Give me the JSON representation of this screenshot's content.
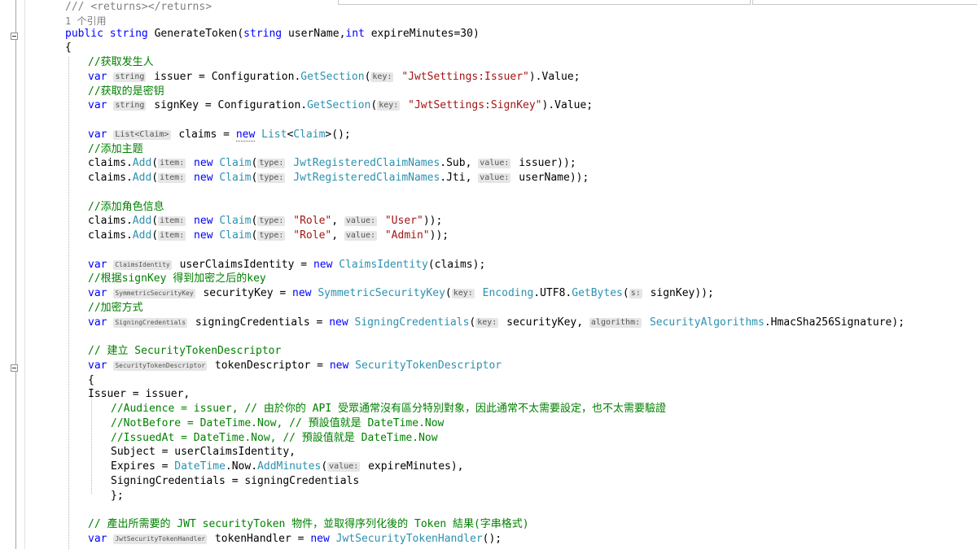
{
  "editor": {
    "lines": [
      [
        {
          "t": "/// ",
          "c": "doc"
        },
        {
          "t": "<returns></returns>",
          "c": "doc"
        }
      ],
      [
        {
          "t": "1 个引用",
          "c": "ref"
        }
      ],
      [
        {
          "t": "public",
          "c": "kw"
        },
        {
          "t": " "
        },
        {
          "t": "string",
          "c": "kw"
        },
        {
          "t": " GenerateToken("
        },
        {
          "t": "string",
          "c": "kw"
        },
        {
          "t": " userName,"
        },
        {
          "t": "int",
          "c": "kw"
        },
        {
          "t": " expireMinutes=30)"
        }
      ],
      [
        {
          "t": "{"
        }
      ],
      [
        {
          "t": "//获取发生人",
          "c": "cm"
        }
      ],
      [
        {
          "t": "var",
          "c": "kw"
        },
        {
          "t": " "
        },
        {
          "t": "string",
          "c": "hint"
        },
        {
          "t": " issuer = Configuration."
        },
        {
          "t": "GetSection",
          "c": "ty"
        },
        {
          "t": "("
        },
        {
          "t": "key:",
          "c": "hint"
        },
        {
          "t": " "
        },
        {
          "t": "\"JwtSettings:Issuer\"",
          "c": "str"
        },
        {
          "t": ").Value;"
        }
      ],
      [
        {
          "t": "//获取的是密钥",
          "c": "cm"
        }
      ],
      [
        {
          "t": "var",
          "c": "kw"
        },
        {
          "t": " "
        },
        {
          "t": "string",
          "c": "hint"
        },
        {
          "t": " signKey = Configuration."
        },
        {
          "t": "GetSection",
          "c": "ty"
        },
        {
          "t": "("
        },
        {
          "t": "key:",
          "c": "hint"
        },
        {
          "t": " "
        },
        {
          "t": "\"JwtSettings:SignKey\"",
          "c": "str"
        },
        {
          "t": ").Value;"
        }
      ],
      [],
      [
        {
          "t": "var",
          "c": "kw"
        },
        {
          "t": " "
        },
        {
          "t": "List<Claim>",
          "c": "hint"
        },
        {
          "t": " claims = "
        },
        {
          "t": "new",
          "c": "kw squig"
        },
        {
          "t": " "
        },
        {
          "t": "List",
          "c": "ty"
        },
        {
          "t": "<"
        },
        {
          "t": "Claim",
          "c": "ty"
        },
        {
          "t": ">();"
        }
      ],
      [
        {
          "t": "//添加主题",
          "c": "cm"
        }
      ],
      [
        {
          "t": "claims."
        },
        {
          "t": "Add",
          "c": "ty"
        },
        {
          "t": "("
        },
        {
          "t": "item:",
          "c": "hint"
        },
        {
          "t": " "
        },
        {
          "t": "new",
          "c": "kw"
        },
        {
          "t": " "
        },
        {
          "t": "Claim",
          "c": "ty"
        },
        {
          "t": "("
        },
        {
          "t": "type:",
          "c": "hint"
        },
        {
          "t": " "
        },
        {
          "t": "JwtRegisteredClaimNames",
          "c": "ty"
        },
        {
          "t": ".Sub, "
        },
        {
          "t": "value:",
          "c": "hint"
        },
        {
          "t": " issuer));"
        }
      ],
      [
        {
          "t": "claims."
        },
        {
          "t": "Add",
          "c": "ty"
        },
        {
          "t": "("
        },
        {
          "t": "item:",
          "c": "hint"
        },
        {
          "t": " "
        },
        {
          "t": "new",
          "c": "kw"
        },
        {
          "t": " "
        },
        {
          "t": "Claim",
          "c": "ty"
        },
        {
          "t": "("
        },
        {
          "t": "type:",
          "c": "hint"
        },
        {
          "t": " "
        },
        {
          "t": "JwtRegisteredClaimNames",
          "c": "ty"
        },
        {
          "t": ".Jti, "
        },
        {
          "t": "value:",
          "c": "hint"
        },
        {
          "t": " userName));"
        }
      ],
      [],
      [
        {
          "t": "//添加角色信息",
          "c": "cm"
        }
      ],
      [
        {
          "t": "claims."
        },
        {
          "t": "Add",
          "c": "ty"
        },
        {
          "t": "("
        },
        {
          "t": "item:",
          "c": "hint"
        },
        {
          "t": " "
        },
        {
          "t": "new",
          "c": "kw"
        },
        {
          "t": " "
        },
        {
          "t": "Claim",
          "c": "ty"
        },
        {
          "t": "("
        },
        {
          "t": "type:",
          "c": "hint"
        },
        {
          "t": " "
        },
        {
          "t": "\"Role\"",
          "c": "str"
        },
        {
          "t": ", "
        },
        {
          "t": "value:",
          "c": "hint"
        },
        {
          "t": " "
        },
        {
          "t": "\"User\"",
          "c": "str"
        },
        {
          "t": "));"
        }
      ],
      [
        {
          "t": "claims."
        },
        {
          "t": "Add",
          "c": "ty"
        },
        {
          "t": "("
        },
        {
          "t": "item:",
          "c": "hint"
        },
        {
          "t": " "
        },
        {
          "t": "new",
          "c": "kw"
        },
        {
          "t": " "
        },
        {
          "t": "Claim",
          "c": "ty"
        },
        {
          "t": "("
        },
        {
          "t": "type:",
          "c": "hint"
        },
        {
          "t": " "
        },
        {
          "t": "\"Role\"",
          "c": "str"
        },
        {
          "t": ", "
        },
        {
          "t": "value:",
          "c": "hint"
        },
        {
          "t": " "
        },
        {
          "t": "\"Admin\"",
          "c": "str"
        },
        {
          "t": "));"
        }
      ],
      [],
      [
        {
          "t": "var",
          "c": "kw"
        },
        {
          "t": " "
        },
        {
          "t": "ClaimsIdentity",
          "c": "hint sm"
        },
        {
          "t": " userClaimsIdentity = "
        },
        {
          "t": "new",
          "c": "kw"
        },
        {
          "t": " "
        },
        {
          "t": "ClaimsIdentity",
          "c": "ty"
        },
        {
          "t": "(claims);"
        }
      ],
      [
        {
          "t": "//根据signKey 得到加密之后的key",
          "c": "cm"
        }
      ],
      [
        {
          "t": "var",
          "c": "kw"
        },
        {
          "t": " "
        },
        {
          "t": "SymmetricSecurityKey",
          "c": "hint sm"
        },
        {
          "t": " securityKey = "
        },
        {
          "t": "new",
          "c": "kw"
        },
        {
          "t": " "
        },
        {
          "t": "SymmetricSecurityKey",
          "c": "ty"
        },
        {
          "t": "("
        },
        {
          "t": "key:",
          "c": "hint"
        },
        {
          "t": " "
        },
        {
          "t": "Encoding",
          "c": "ty"
        },
        {
          "t": ".UTF8."
        },
        {
          "t": "GetBytes",
          "c": "ty"
        },
        {
          "t": "("
        },
        {
          "t": "s:",
          "c": "hint"
        },
        {
          "t": " signKey));"
        }
      ],
      [
        {
          "t": "//加密方式",
          "c": "cm"
        }
      ],
      [
        {
          "t": "var",
          "c": "kw"
        },
        {
          "t": " "
        },
        {
          "t": "SigningCredentials",
          "c": "hint sm"
        },
        {
          "t": " signingCredentials = "
        },
        {
          "t": "new",
          "c": "kw"
        },
        {
          "t": " "
        },
        {
          "t": "SigningCredentials",
          "c": "ty"
        },
        {
          "t": "("
        },
        {
          "t": "key:",
          "c": "hint"
        },
        {
          "t": " securityKey, "
        },
        {
          "t": "algorithm:",
          "c": "hint"
        },
        {
          "t": " "
        },
        {
          "t": "SecurityAlgorithms",
          "c": "ty"
        },
        {
          "t": ".HmacSha256Signature);"
        }
      ],
      [],
      [
        {
          "t": "// 建立 SecurityTokenDescriptor",
          "c": "cm"
        }
      ],
      [
        {
          "t": "var",
          "c": "kw"
        },
        {
          "t": " "
        },
        {
          "t": "SecurityTokenDescriptor",
          "c": "hint sm"
        },
        {
          "t": " tokenDescriptor = "
        },
        {
          "t": "new",
          "c": "kw"
        },
        {
          "t": " "
        },
        {
          "t": "SecurityTokenDescriptor",
          "c": "ty"
        }
      ],
      [
        {
          "t": "{"
        }
      ],
      [
        {
          "t": "Issuer = issuer,"
        }
      ],
      [
        {
          "t": "//Audience = issuer, // 由於你的 API 受眾通常沒有區分特別對象，因此通常不太需要設定，也不太需要驗證",
          "c": "cm"
        }
      ],
      [
        {
          "t": "//NotBefore = DateTime.Now, // 預設值就是 DateTime.Now",
          "c": "cm"
        }
      ],
      [
        {
          "t": "//IssuedAt = DateTime.Now, // 預設值就是 DateTime.Now",
          "c": "cm"
        }
      ],
      [
        {
          "t": "Subject = userClaimsIdentity,"
        }
      ],
      [
        {
          "t": "Expires = "
        },
        {
          "t": "DateTime",
          "c": "ty"
        },
        {
          "t": ".Now."
        },
        {
          "t": "AddMinutes",
          "c": "ty"
        },
        {
          "t": "("
        },
        {
          "t": "value:",
          "c": "hint"
        },
        {
          "t": " expireMinutes),"
        }
      ],
      [
        {
          "t": "SigningCredentials = signingCredentials"
        }
      ],
      [
        {
          "t": "};"
        }
      ],
      [],
      [
        {
          "t": "// 產出所需要的 JWT securityToken 物件，並取得序列化後的 Token 結果(字串格式)",
          "c": "cm"
        }
      ],
      [
        {
          "t": "var",
          "c": "kw"
        },
        {
          "t": " "
        },
        {
          "t": "JwtSecurityTokenHandler",
          "c": "hint sm"
        },
        {
          "t": " tokenHandler = "
        },
        {
          "t": "new",
          "c": "kw"
        },
        {
          "t": " "
        },
        {
          "t": "JwtSecurityTokenHandler",
          "c": "ty"
        },
        {
          "t": "();"
        }
      ]
    ]
  }
}
